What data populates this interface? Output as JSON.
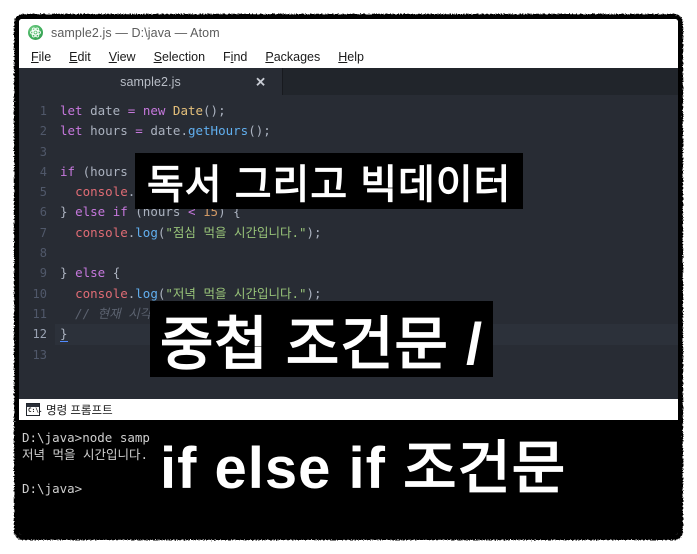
{
  "window": {
    "title": "sample2.js — D:\\java — Atom",
    "app_icon": "atom-logo-icon"
  },
  "menubar": {
    "items": [
      {
        "label": "File",
        "mnemonic": "F",
        "rest": "ile"
      },
      {
        "label": "Edit",
        "mnemonic": "E",
        "rest": "dit"
      },
      {
        "label": "View",
        "mnemonic": "V",
        "rest": "iew"
      },
      {
        "label": "Selection",
        "mnemonic": "S",
        "rest": "election"
      },
      {
        "label": "Find",
        "mnemonic": "i",
        "pre": "F",
        "rest": "nd"
      },
      {
        "label": "Packages",
        "mnemonic": "P",
        "rest": "ackages"
      },
      {
        "label": "Help",
        "mnemonic": "H",
        "rest": "elp"
      }
    ]
  },
  "tabs": {
    "active": "sample2.js",
    "close_glyph": "✕"
  },
  "editor": {
    "language": "javascript",
    "line_numbers": [
      "1",
      "2",
      "3",
      "4",
      "5",
      "6",
      "7",
      "8",
      "9",
      "10",
      "11",
      "12",
      "13"
    ],
    "current_line": "12",
    "lines": [
      {
        "n": "1",
        "text": "let date = new Date();"
      },
      {
        "n": "2",
        "text": "let hours = date.getHours();"
      },
      {
        "n": "3",
        "text": ""
      },
      {
        "n": "4",
        "text": "if (hours < 11) {"
      },
      {
        "n": "5",
        "text": "  console.log(\"아침 먹을 시간입니다\");"
      },
      {
        "n": "6",
        "text": "} else if (hours < 15) {"
      },
      {
        "n": "7",
        "text": "  console.log(\"점심 먹을 시간입니다.\");"
      },
      {
        "n": "8",
        "text": ""
      },
      {
        "n": "9",
        "text": "} else {"
      },
      {
        "n": "10",
        "text": "  console.log(\"저녁 먹을 시간입니다.\");"
      },
      {
        "n": "11",
        "text": "  // 현재 시각을 확인해서 분기"
      },
      {
        "n": "12",
        "text": "}"
      },
      {
        "n": "13",
        "text": ""
      }
    ],
    "colors": {
      "background": "#282c34",
      "gutter_text": "#50586a",
      "foreground": "#abb2bf",
      "keyword": "#c678dd",
      "class": "#e5c07b",
      "function": "#61afef",
      "object": "#e06c75",
      "string": "#98c379",
      "number": "#d19a66",
      "comment": "#5c6370",
      "cursor": "#528bff"
    }
  },
  "terminal": {
    "title": "명령 프롬프트",
    "icon": "cmd-console-icon",
    "icon_text": "C:\\.",
    "lines": [
      "D:\\java>node sample2.js",
      "저녁 먹을 시간입니다.",
      "",
      "D:\\java>"
    ],
    "colors": {
      "background": "#000000",
      "foreground": "#cfcfcf"
    }
  },
  "overlay": {
    "line1": "독서 그리고 빅데이터",
    "line2": "중첩 조건문 /",
    "line3": "if else if 조건문",
    "colors": {
      "background": "#000000",
      "text": "#ffffff"
    }
  },
  "frame": {
    "border_color": "#000000",
    "page_background": "#ffffff"
  }
}
